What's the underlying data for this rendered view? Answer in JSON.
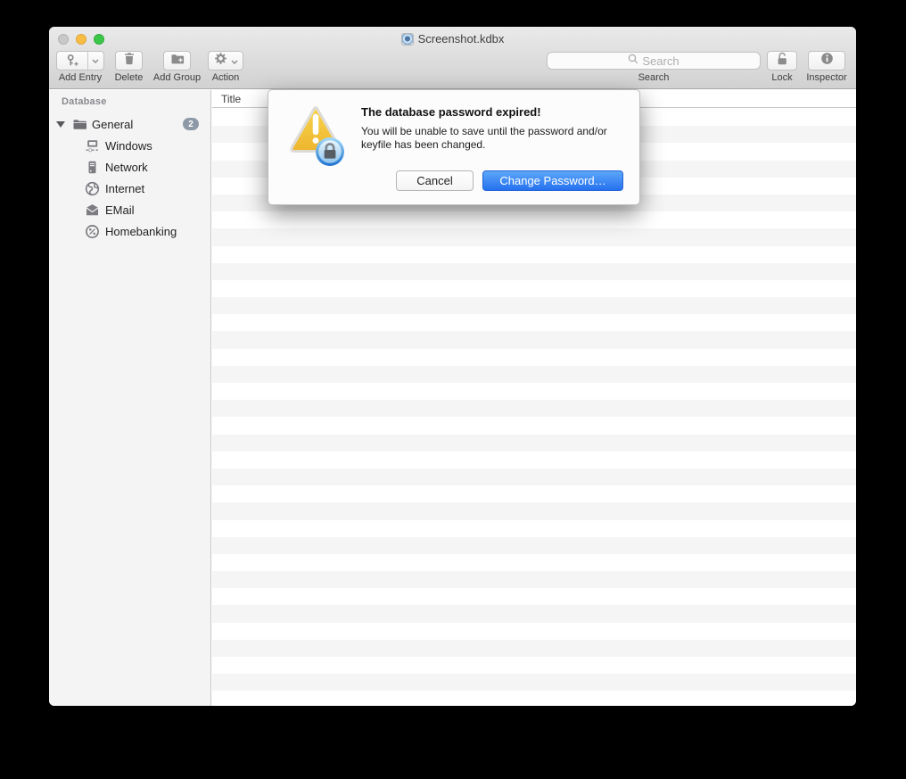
{
  "window": {
    "title": "Screenshot.kdbx",
    "traffic_lights": [
      "close-disabled",
      "minimize",
      "zoom"
    ]
  },
  "toolbar": {
    "items": [
      {
        "label": "Add Entry",
        "icon": "key-plus-icon",
        "has_dropdown": true
      },
      {
        "label": "Delete",
        "icon": "trash-icon",
        "has_dropdown": false
      },
      {
        "label": "Add Group",
        "icon": "folder-plus-icon",
        "has_dropdown": false
      },
      {
        "label": "Action",
        "icon": "gear-icon",
        "has_dropdown": true
      }
    ],
    "search": {
      "placeholder": "Search",
      "label": "Search",
      "icon": "search-icon"
    },
    "lock": {
      "label": "Lock",
      "icon": "open-padlock-icon"
    },
    "inspector": {
      "label": "Inspector",
      "icon": "info-icon"
    }
  },
  "sidebar": {
    "header": "Database",
    "root": {
      "label": "General",
      "badge": "2",
      "expanded": true,
      "icon": "folder",
      "children": [
        {
          "label": "Windows",
          "icon": "windows"
        },
        {
          "label": "Network",
          "icon": "network"
        },
        {
          "label": "Internet",
          "icon": "internet"
        },
        {
          "label": "EMail",
          "icon": "email"
        },
        {
          "label": "Homebanking",
          "icon": "homebanking"
        }
      ]
    }
  },
  "content": {
    "columns": [
      {
        "label": "Title"
      }
    ],
    "row_count": 35,
    "rows": []
  },
  "dialog": {
    "icon": "warning-triangle-lock-icon",
    "title": "The database password expired!",
    "message": "You will be unable to save until the password and/or keyfile has been changed.",
    "cancel_label": "Cancel",
    "primary_label": "Change Password…"
  },
  "colors": {
    "accent_blue": "#2f7ef2",
    "warning_yellow": "#f2c23e",
    "badge_gray_blue": "#8e99a7",
    "toolbar_gradient_top": "#ebeaeb",
    "toolbar_gradient_bottom": "#d2d1d2",
    "sidebar_bg": "#f5f4f5",
    "row_stripe": "#f5f5f5"
  }
}
